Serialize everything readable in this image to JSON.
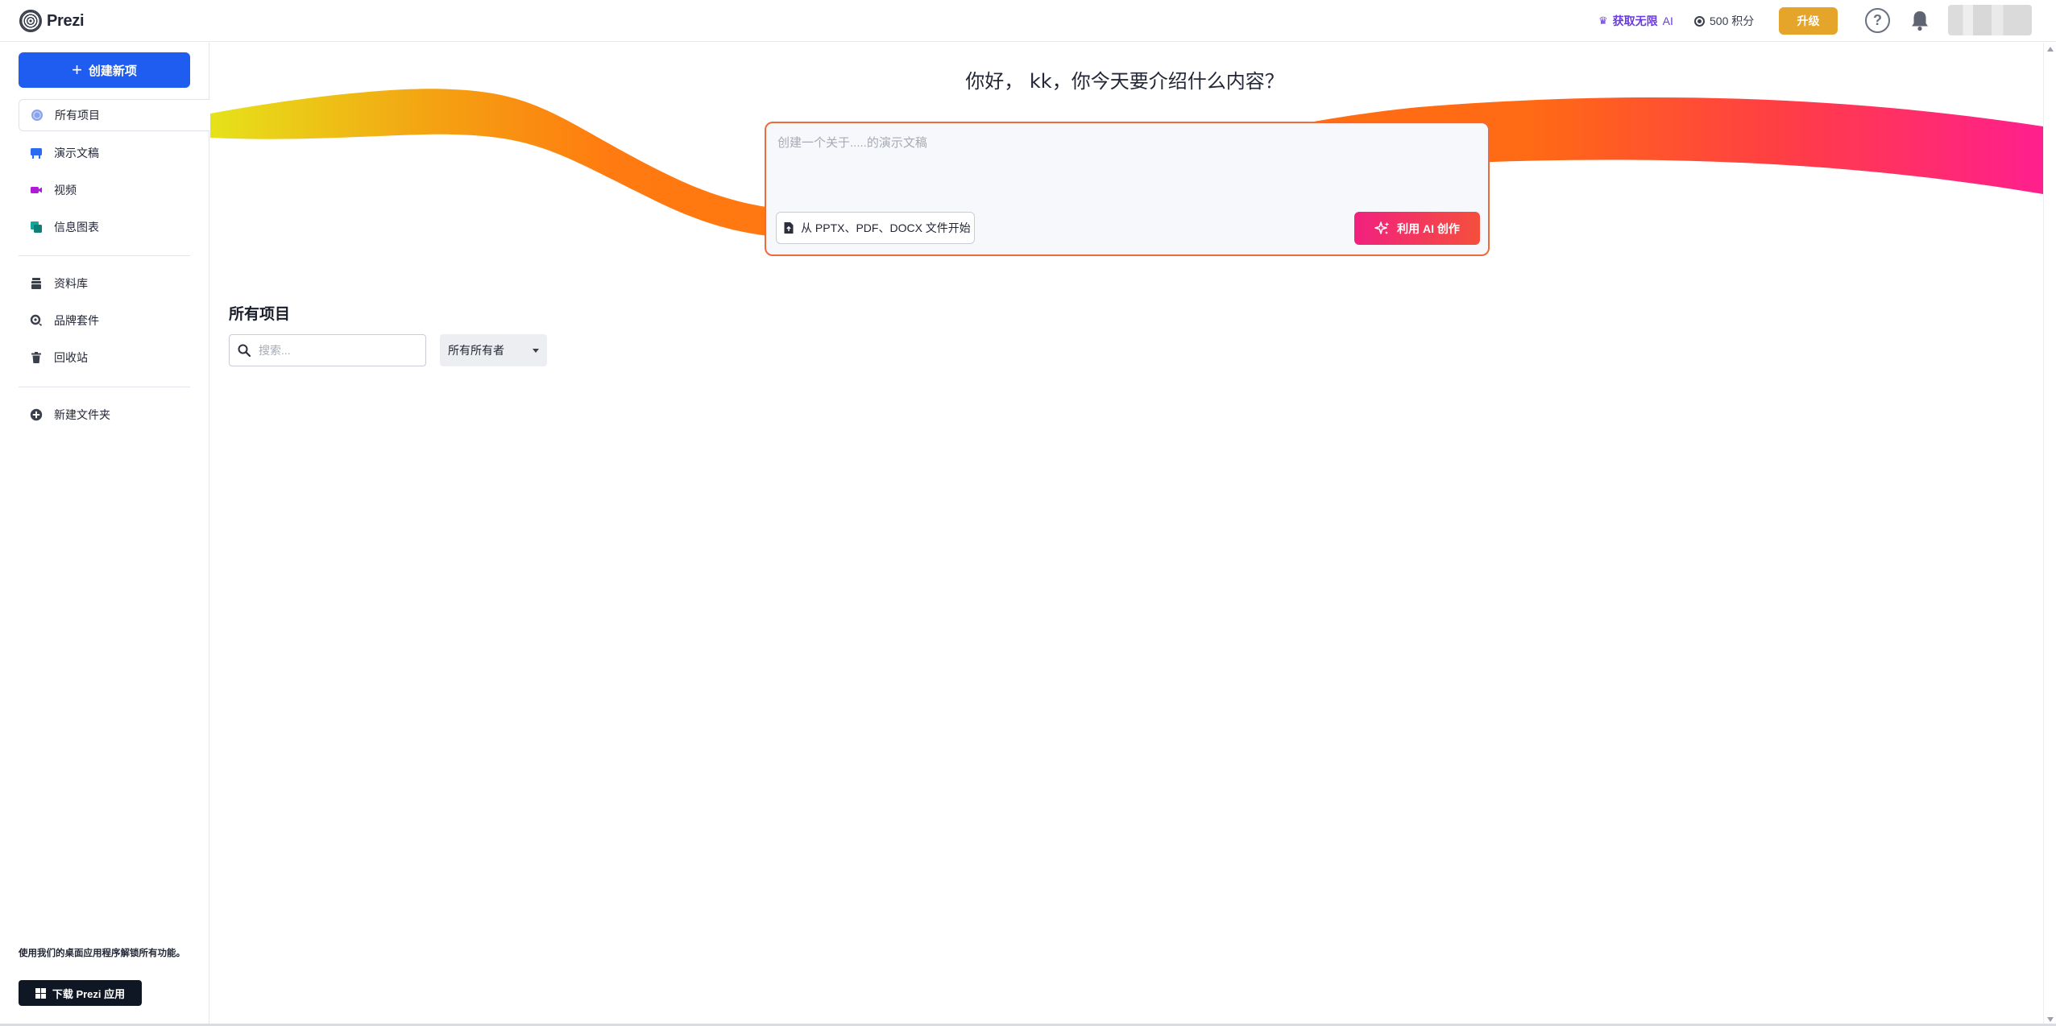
{
  "brand": {
    "name": "Prezi"
  },
  "header": {
    "get_ai_label": "获取无限",
    "get_ai_suffix": "AI",
    "credits_label": "500 积分",
    "upgrade_label": "升级",
    "help_label": "?"
  },
  "sidebar": {
    "create_label": "创建新项",
    "items": [
      {
        "label": "所有项目",
        "icon": "globe-icon",
        "color": "#6f8fe8"
      },
      {
        "label": "演示文稿",
        "icon": "presentation-icon",
        "color": "#2a6cf0"
      },
      {
        "label": "视频",
        "icon": "video-icon",
        "color": "#b21bd6"
      },
      {
        "label": "信息图表",
        "icon": "infographic-icon",
        "color": "#15a59a"
      }
    ],
    "library_items": [
      {
        "label": "资料库",
        "icon": "library-icon"
      },
      {
        "label": "品牌套件",
        "icon": "brand-kit-icon"
      },
      {
        "label": "回收站",
        "icon": "trash-icon"
      }
    ],
    "new_folder_label": "新建文件夹",
    "desktop_note": "使用我们的桌面应用程序解锁所有功能。",
    "download_label": "下载 Prezi 应用"
  },
  "main": {
    "greeting": "你好， kk，你今天要介绍什么内容？",
    "prompt_placeholder": "创建一个关于.....的演示文稿",
    "upload_label": "从 PPTX、PDF、DOCX 文件开始",
    "ai_create_label": "利用 AI 创作",
    "section_title": "所有项目",
    "search_placeholder": "搜索...",
    "owner_filter": "所有所有者"
  },
  "colors": {
    "primary": "#1f5cf0",
    "upgrade": "#e5a52b",
    "ai_gradient_start": "#f2207f",
    "ai_gradient_end": "#f44f3c",
    "ribbon_start": "#e6e21a",
    "ribbon_mid": "#ff7a10",
    "ribbon_end": "#ff1f8e"
  }
}
